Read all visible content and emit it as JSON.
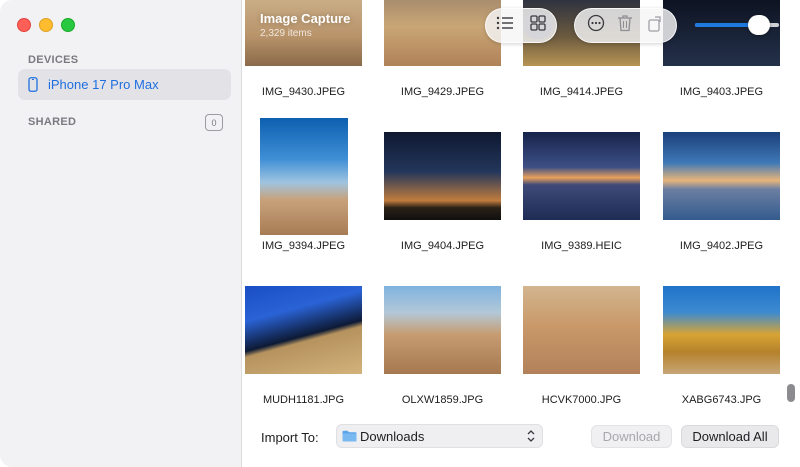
{
  "app": {
    "title": "Image Capture",
    "item_count": "2,329 items"
  },
  "sidebar": {
    "devices_label": "DEVICES",
    "device_name": "iPhone 17 Pro Max",
    "shared_label": "SHARED",
    "shared_count": "0"
  },
  "toolbar": {
    "list_view_icon": "list-icon",
    "grid_view_icon": "grid-icon",
    "active_view": "grid",
    "more_icon": "ellipsis-circle-icon",
    "delete_icon": "trash-icon",
    "rotate_icon": "rotate-icon",
    "thumbnail_size": 0.85
  },
  "photos": [
    {
      "name": "IMG_9430.JPEG",
      "look": "p-desert-top"
    },
    {
      "name": "IMG_9429.JPEG",
      "look": "p-desert-top2"
    },
    {
      "name": "IMG_9414.JPEG",
      "look": "p-dusk-top"
    },
    {
      "name": "IMG_9403.JPEG",
      "look": "p-night-top"
    },
    {
      "name": "IMG_9394.JPEG",
      "look": "p-tree-tall"
    },
    {
      "name": "IMG_9404.JPEG",
      "look": "p-sunset-trees"
    },
    {
      "name": "IMG_9389.HEIC",
      "look": "p-lake-dusk"
    },
    {
      "name": "IMG_9402.JPEG",
      "look": "p-lake-sunset"
    },
    {
      "name": "MUDH1181.JPG",
      "look": "p-dune"
    },
    {
      "name": "OLXW1859.JPG",
      "look": "p-camels"
    },
    {
      "name": "HCVK7000.JPG",
      "look": "p-camel-close"
    },
    {
      "name": "XABG6743.JPG",
      "look": "p-poplar"
    }
  ],
  "bottom": {
    "import_label": "Import To:",
    "destination": "Downloads",
    "download_label": "Download",
    "download_all_label": "Download All"
  },
  "colors": {
    "accent": "#1f7ae0",
    "sidebar_bg": "#f2f2f4",
    "selected_item_text": "#1e6fe0"
  }
}
